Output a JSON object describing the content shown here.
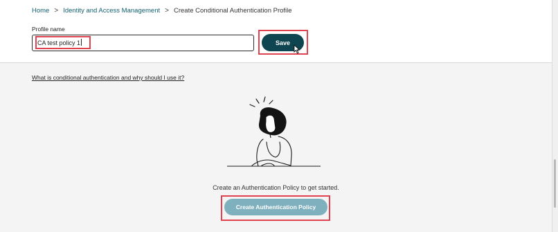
{
  "breadcrumb": {
    "home": "Home",
    "section": "Identity and Access Management",
    "current": "Create Conditional Authentication Profile",
    "separator": ">"
  },
  "profile": {
    "label": "Profile name",
    "value": "CA test policy 1"
  },
  "save_label": "Save",
  "help_link": "What is conditional authentication and why should I use it?",
  "empty_state": {
    "text": "Create an Authentication Policy to get started.",
    "button_label": "Create Authentication Policy"
  },
  "colors": {
    "primary": "#0e4551",
    "primary_muted": "#7fb0bd",
    "link": "#0f5f6e",
    "highlight": "#e0434f"
  }
}
